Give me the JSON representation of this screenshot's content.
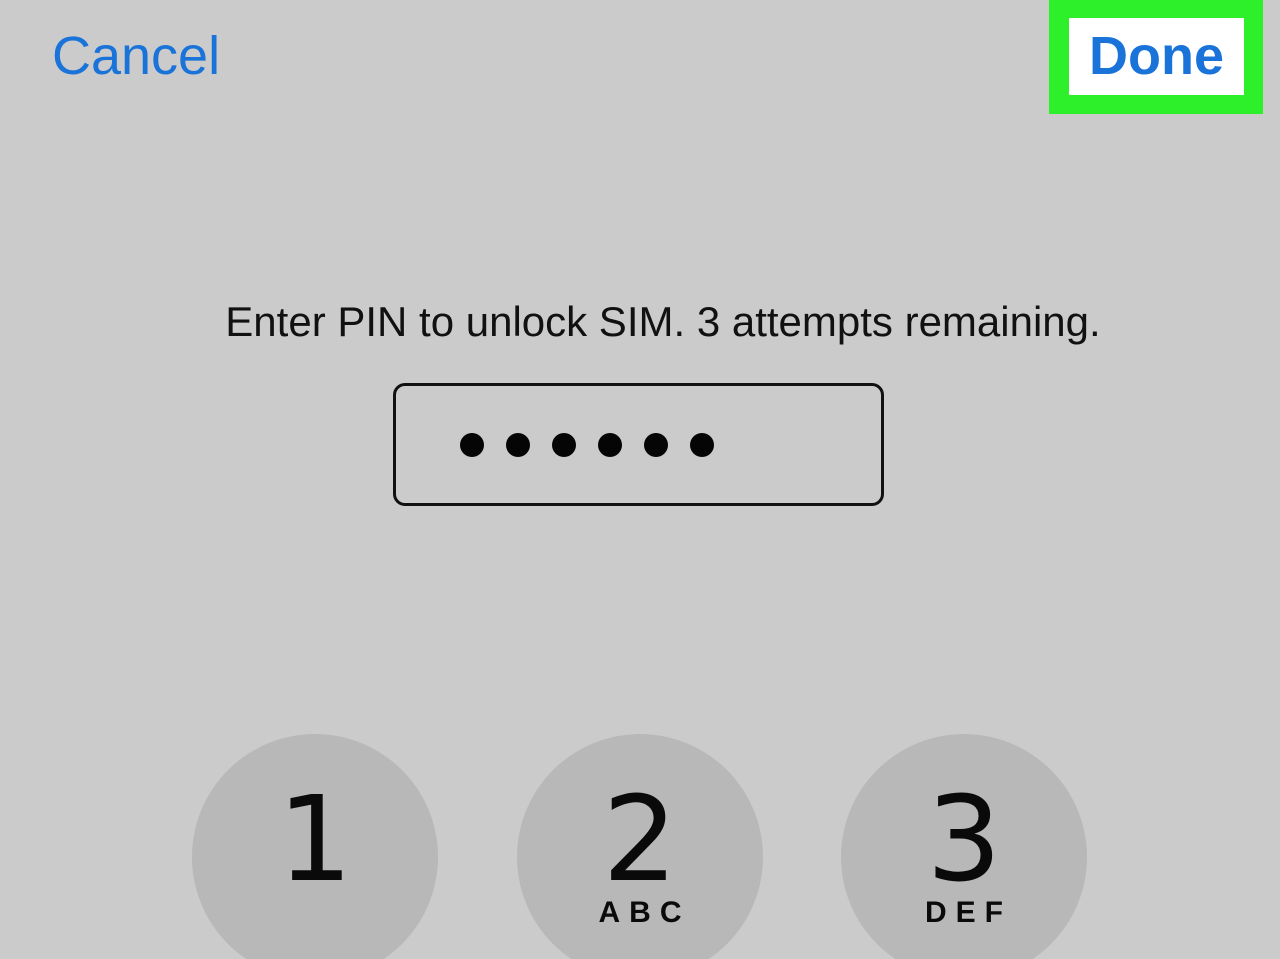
{
  "header": {
    "cancel_label": "Cancel",
    "done_label": "Done"
  },
  "prompt": {
    "message": "Enter PIN to unlock SIM. 3 attempts remaining."
  },
  "pin_field": {
    "entered_digit_count": 6
  },
  "keypad": {
    "keys": [
      {
        "digit": "1",
        "letters": ""
      },
      {
        "digit": "2",
        "letters": "ABC"
      },
      {
        "digit": "3",
        "letters": "DEF"
      }
    ]
  },
  "colors": {
    "background": "#cbcbcb",
    "link_blue": "#1a73d9",
    "highlight_green": "#2ef02a",
    "key_gray": "#b8b8b8"
  }
}
